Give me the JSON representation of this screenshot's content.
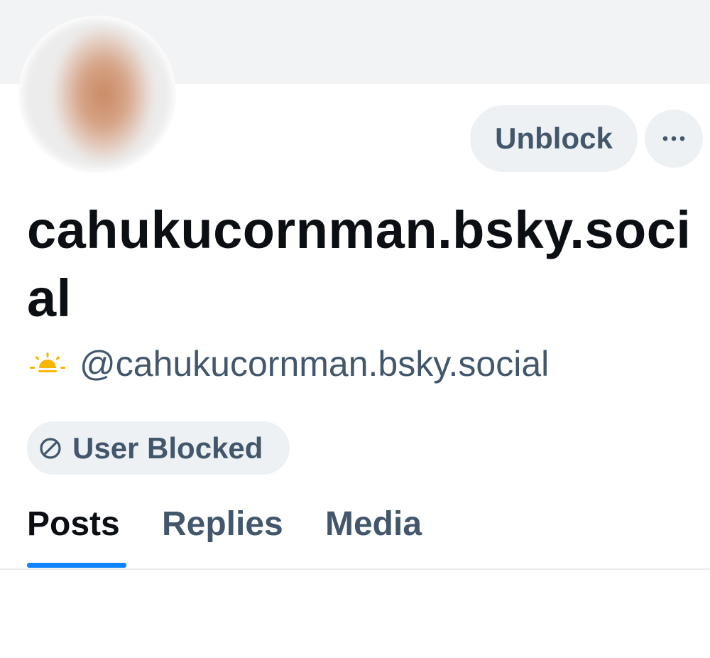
{
  "profile": {
    "display_name": "cahukucornman.bsky.social",
    "handle": "@cahukucornman.bsky.social",
    "handle_emoji": "sunrise-icon",
    "avatar": "blurred-avatar"
  },
  "actions": {
    "unblock_label": "Unblock",
    "more_icon": "ellipsis-icon"
  },
  "badge": {
    "label": "User Blocked",
    "icon": "blocked-icon"
  },
  "tabs": [
    {
      "label": "Posts",
      "active": true
    },
    {
      "label": "Replies",
      "active": false
    },
    {
      "label": "Media",
      "active": false
    }
  ],
  "colors": {
    "accent": "#1083fe",
    "secondary_text": "#42576c",
    "primary_text": "#0b0f14",
    "pill_background": "#eef1f4",
    "banner": "#f1f3f5",
    "emoji_sun": "#f7b500"
  }
}
